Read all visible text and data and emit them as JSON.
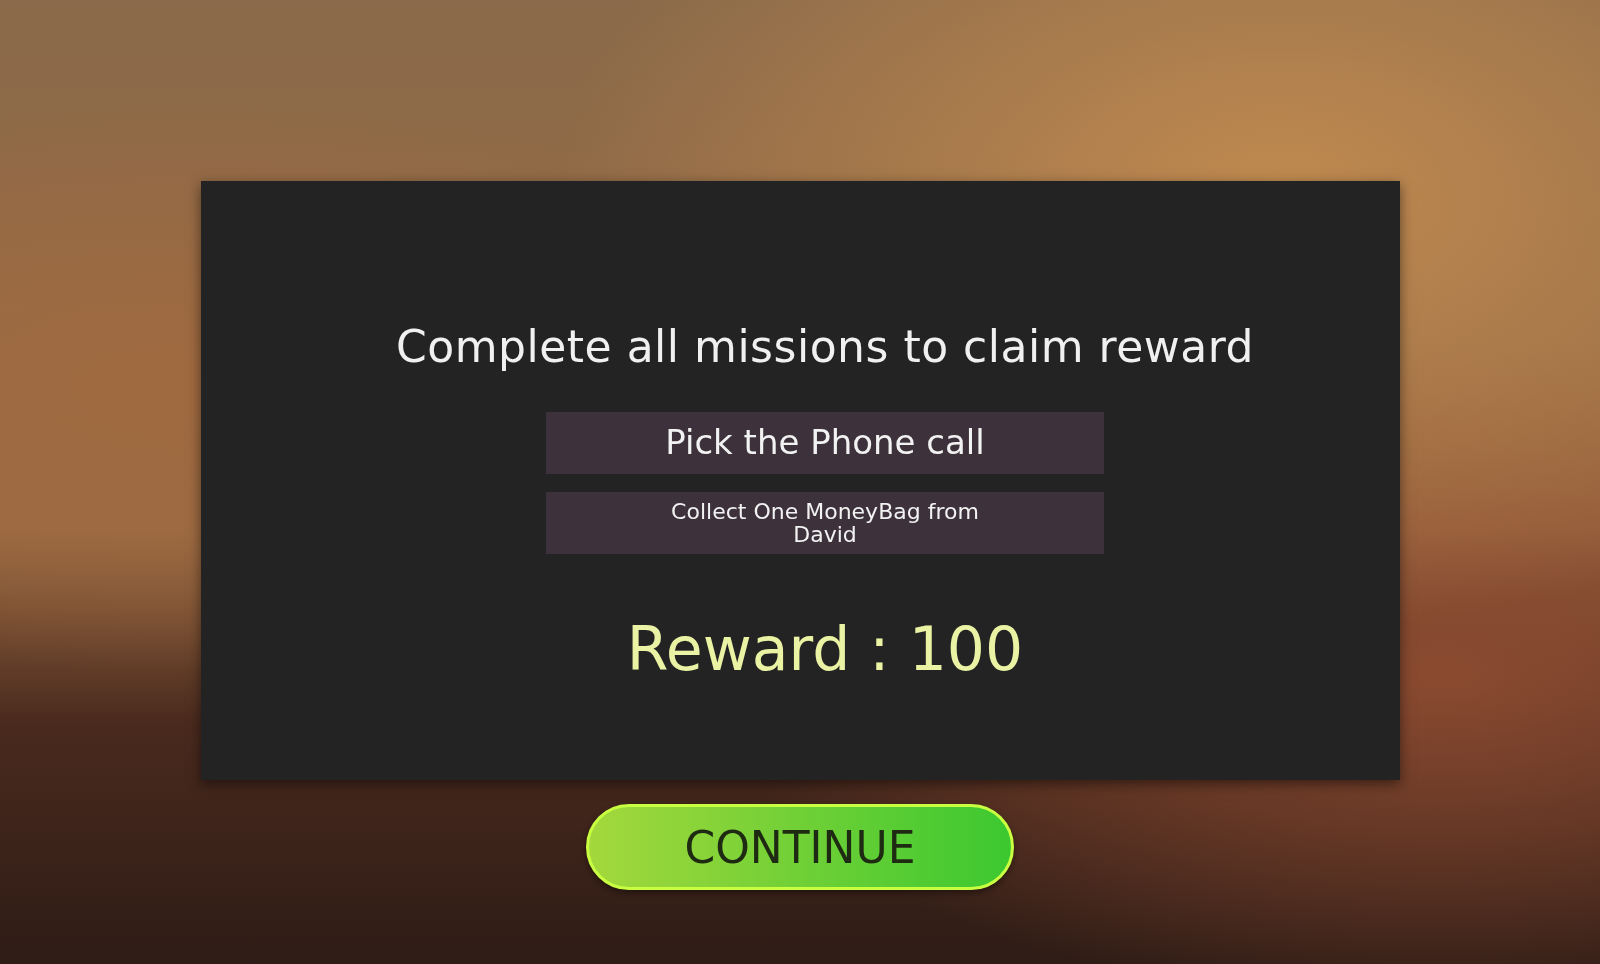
{
  "dialog": {
    "title": "Complete all missions to claim reward",
    "missions": [
      {
        "label": "Pick the Phone call"
      },
      {
        "label": "Collect One MoneyBag from David"
      }
    ],
    "reward": "Reward : 100"
  },
  "continue_button": {
    "label": "CONTINUE"
  }
}
